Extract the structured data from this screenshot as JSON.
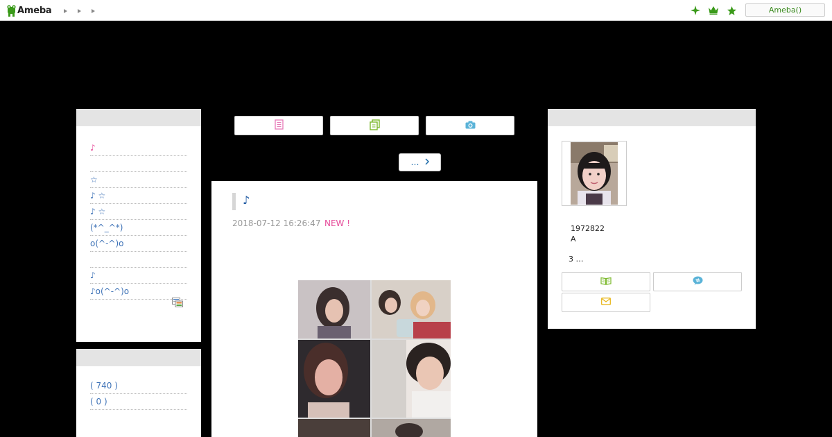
{
  "header": {
    "logo_text": "Ameba",
    "ameba_button": "Ameba()"
  },
  "themes": {
    "items": [
      {
        "label": "♪",
        "color": "#e64c9a"
      },
      {
        "label": ""
      },
      {
        "label": "☆"
      },
      {
        "label": "♪ ☆"
      },
      {
        "label": "♪ ☆"
      },
      {
        "label": "(*^_^*)"
      },
      {
        "label": "o(^-^)o"
      },
      {
        "label": ""
      },
      {
        "label": " ♪"
      },
      {
        "label": "♪o(^-^)o"
      }
    ]
  },
  "archive": {
    "items": [
      {
        "label": " ( 740 )"
      },
      {
        "label": " ( 0 )"
      }
    ]
  },
  "nav": {
    "more_label": "…"
  },
  "article": {
    "title": "♪",
    "date": "2018-07-12 16:26:47",
    "new_badge": "NEW !"
  },
  "profile": {
    "line1": "1972822",
    "line2": "A",
    "bio": "3 …"
  },
  "colors": {
    "green": "#3a9a1a",
    "pink": "#e64c9a",
    "link": "#3f73b7"
  }
}
